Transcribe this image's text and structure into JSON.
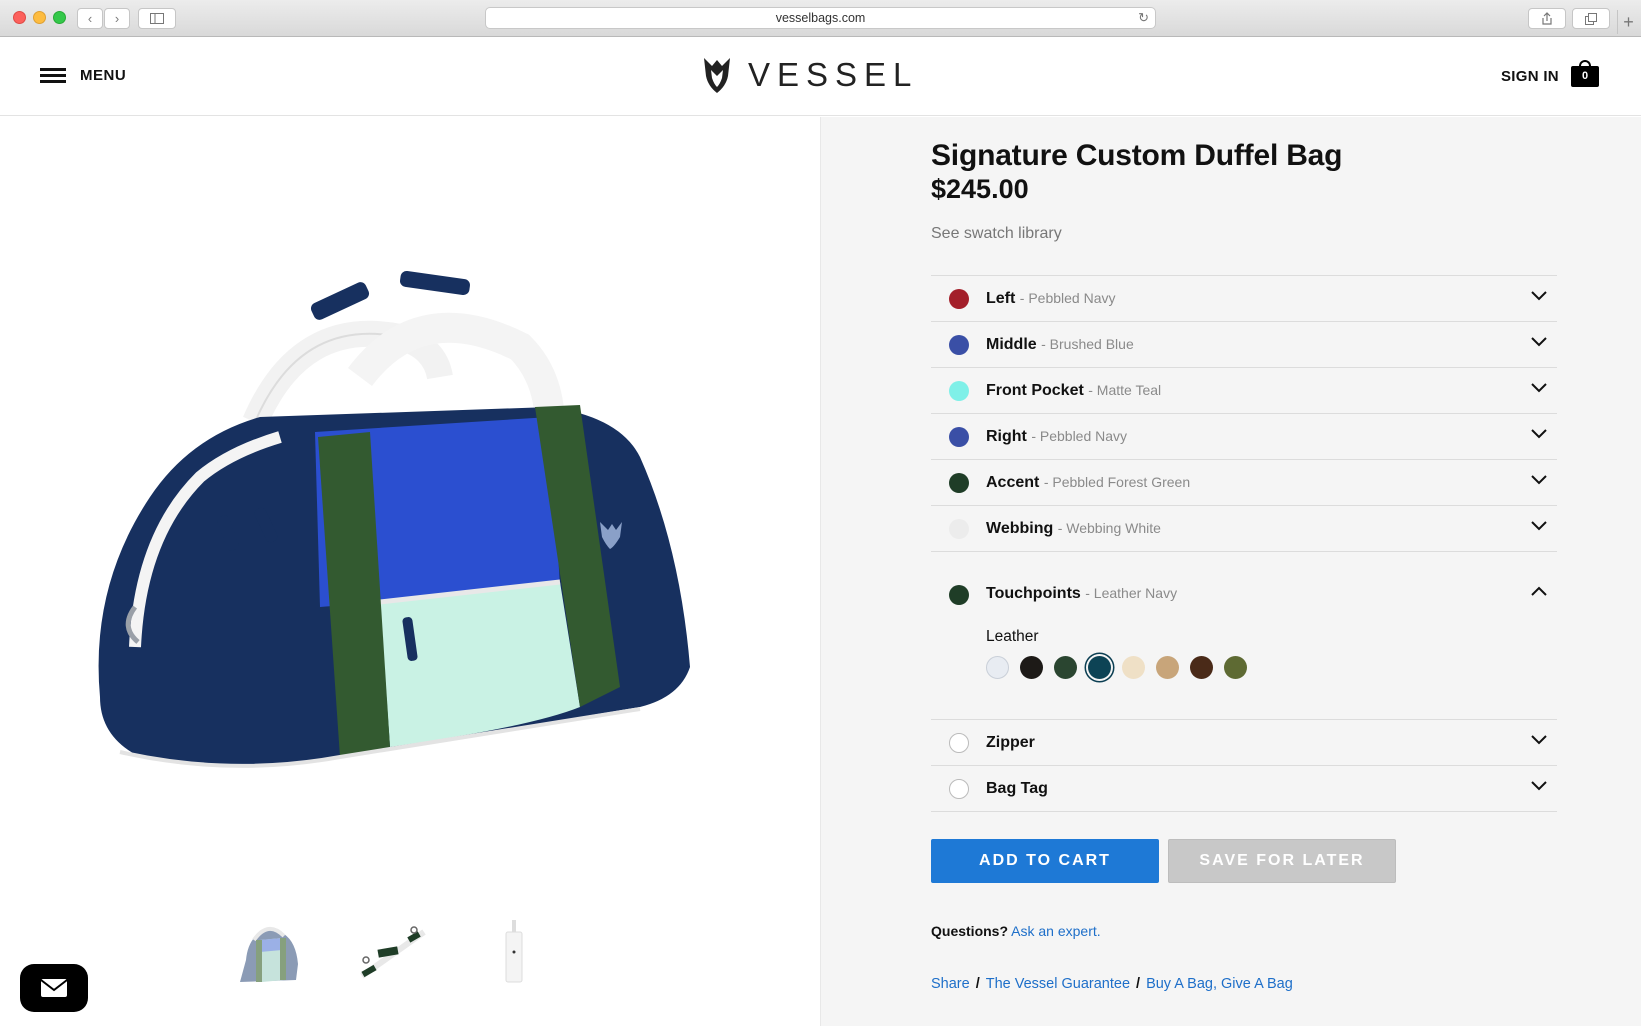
{
  "browser": {
    "url": "vesselbags.com"
  },
  "header": {
    "menu_label": "MENU",
    "brand": "VESSEL",
    "signin_label": "SIGN IN",
    "cart_count": "0"
  },
  "product": {
    "title": "Signature Custom Duffel Bag",
    "price": "$245.00",
    "swatch_link": "See swatch library"
  },
  "options": [
    {
      "name": "Left",
      "value": "- Pebbled Navy",
      "color": "#a31f2a"
    },
    {
      "name": "Middle",
      "value": "- Brushed Blue",
      "color": "#3a4fa6"
    },
    {
      "name": "Front Pocket",
      "value": "- Matte Teal",
      "color": "#7ff0e8"
    },
    {
      "name": "Right",
      "value": "- Pebbled Navy",
      "color": "#3a4fa6"
    },
    {
      "name": "Accent",
      "value": "- Pebbled Forest Green",
      "color": "#1f3d27"
    },
    {
      "name": "Webbing",
      "value": "- Webbing White",
      "color": "#ececec"
    },
    {
      "name": "Touchpoints",
      "value": "- Leather Navy",
      "color": "#1f3d27"
    },
    {
      "name": "Zipper",
      "value": "",
      "color": "#ffffff"
    },
    {
      "name": "Bag Tag",
      "value": "",
      "color": "#ffffff"
    }
  ],
  "touchpoints": {
    "material_label": "Leather",
    "swatches": [
      "#e8ecf2",
      "#1d1a17",
      "#2a4530",
      "#0d4355",
      "#efe0c6",
      "#c8a57a",
      "#4a2a18",
      "#5e6a33"
    ],
    "selected_index": 3
  },
  "actions": {
    "add_to_cart": "ADD TO CART",
    "save_for_later": "SAVE FOR LATER"
  },
  "help": {
    "questions": "Questions?",
    "ask_expert": "Ask an expert."
  },
  "footer_links": {
    "share": "Share",
    "guarantee": "The Vessel Guarantee",
    "give": "Buy A Bag, Give A Bag",
    "separator": "/"
  },
  "colors": {
    "accent_blue": "#1e79d6",
    "bag_navy": "#17305f",
    "bag_blue": "#2b4fd0",
    "bag_green": "#335a30",
    "bag_mint": "#c9f2e4"
  }
}
